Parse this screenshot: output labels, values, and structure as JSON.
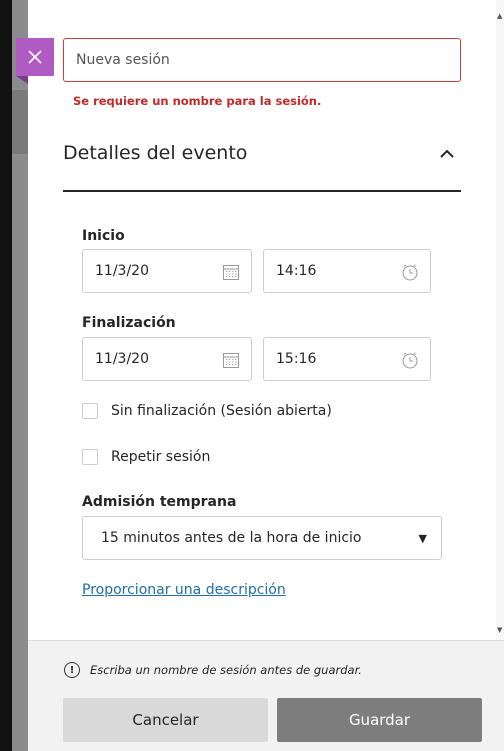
{
  "session": {
    "name_placeholder": "Nueva sesión",
    "name_value": "",
    "error_message": "Se requiere un nombre para la sesión."
  },
  "event_details": {
    "title": "Detalles del evento",
    "expanded": true,
    "start": {
      "label": "Inicio",
      "date": "11/3/20",
      "time": "14:16"
    },
    "end": {
      "label": "Finalización",
      "date": "11/3/20",
      "time": "15:16"
    },
    "no_end": {
      "label": "Sin finalización (Sesión abierta)",
      "checked": false
    },
    "repeat": {
      "label": "Repetir sesión",
      "checked": false
    },
    "early_entry": {
      "label": "Admisión temprana",
      "selected": "15 minutos antes de la hora de inicio"
    },
    "description_link": "Proporcionar una descripción"
  },
  "footer": {
    "note": "Escriba un nombre de sesión antes de guardar.",
    "cancel_label": "Cancelar",
    "save_label": "Guardar"
  },
  "colors": {
    "close_button": "#b05bc4",
    "error": "#c02a2a",
    "link": "#1f6fa8",
    "save_button": "#7d7d7d",
    "cancel_button": "#d9d9d9"
  },
  "icons": {
    "close": "close-icon",
    "collapse": "chevron-up-icon",
    "date": "calendar-icon",
    "time": "clock-icon",
    "select": "caret-down-icon",
    "note": "info-icon"
  }
}
